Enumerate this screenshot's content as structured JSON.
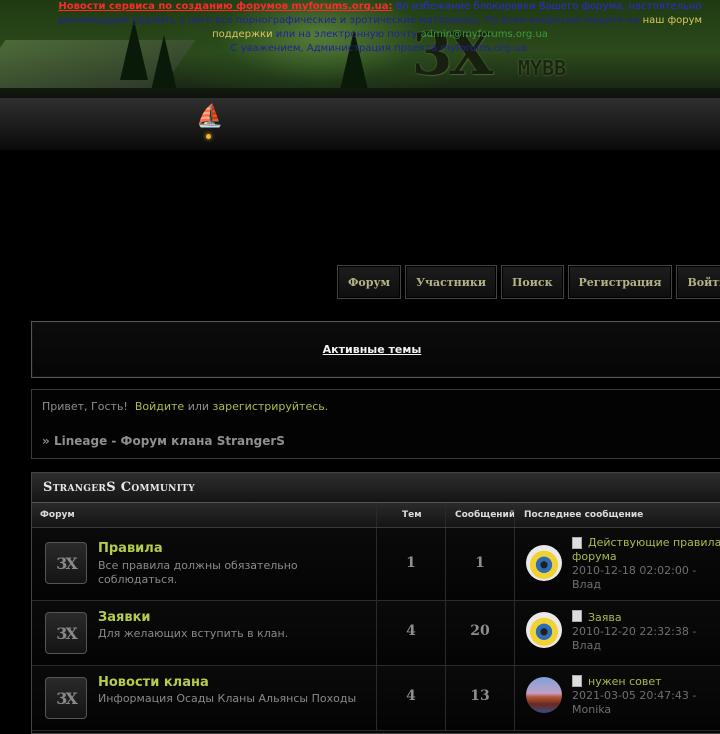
{
  "header": {
    "notice_title": "Новости сервиса по созданию форумов myforums.org.ua:",
    "notice_line1": "Во избежание блокировки Вашего форума, настоятельно",
    "notice_line2": "рекомендуем удалить с него все порнографические и эротические материалы. По всем вопросам пишите на",
    "notice_support_link": "наш форум",
    "notice_line3_start": "поддержки",
    "notice_line3_mid": "или на электронную почту",
    "notice_email": "admin@myforums.org.ua",
    "notice_line4": "С уважением, Администрация проекта myforums.org.ua.",
    "logo_main": "3X",
    "logo_sub": "MYBB"
  },
  "nav": {
    "forum": "Форум",
    "members": "Участники",
    "search": "Поиск",
    "register": "Регистрация",
    "login": "Войти"
  },
  "active_topics": "Активные темы",
  "welcome": {
    "greeting": "Привет, Гость!",
    "login_link": "Войдите",
    "or": "или",
    "register_link": "зарегистрируйтесь.",
    "crumb_sep": "»",
    "crumb": "Lineage - Форум клана StrangerS"
  },
  "category": {
    "title": "StrangerS Community",
    "col_forum": "Форум",
    "col_topics": "Тем",
    "col_posts": "Сообщений",
    "col_last": "Последнее сообщение"
  },
  "forums": [
    {
      "title": "Правила",
      "desc": "Все правила должны обязательно соблюдаться.",
      "topics": "1",
      "posts": "1",
      "last_topic": "Действующие правила форума",
      "last_meta": "2010-12-18 02:02:00 - Влад",
      "avatar": "eye"
    },
    {
      "title": "Заявки",
      "desc": "Для желающих вступить в клан.",
      "topics": "4",
      "posts": "20",
      "last_topic": "Заява",
      "last_meta": "2010-12-20 22:32:38 - Влад",
      "avatar": "eye"
    },
    {
      "title": "Новости клана",
      "desc": "Информация Осады Кланы Альянсы Походы",
      "topics": "4",
      "posts": "13",
      "last_topic": "нужен совет",
      "last_meta": "2021-03-05 20:47:43 - Monika",
      "avatar": "landscape"
    }
  ],
  "icons": {
    "forum_icon": "3x-forum-icon",
    "topic_icon": "document-icon"
  },
  "colors": {
    "link_green": "#b3cc4a",
    "notice_red": "#ff2a2a",
    "notice_blue": "#2222cc",
    "nav_text": "#b5b286"
  }
}
